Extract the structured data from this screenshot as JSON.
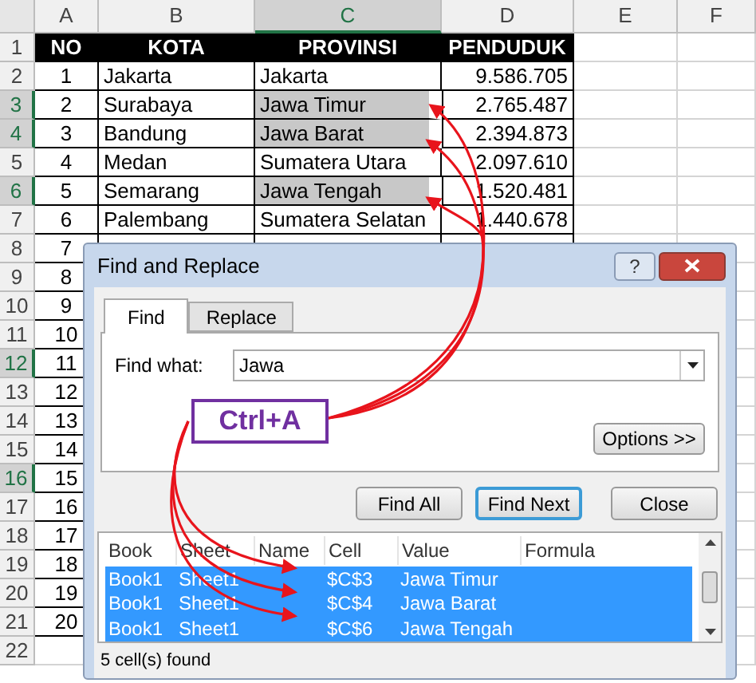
{
  "spreadsheet": {
    "column_headers": [
      {
        "label": "A",
        "selected": false
      },
      {
        "label": "B",
        "selected": false
      },
      {
        "label": "C",
        "selected": true
      },
      {
        "label": "D",
        "selected": false
      },
      {
        "label": "E",
        "selected": false
      },
      {
        "label": "F",
        "selected": false
      }
    ],
    "row_headers": [
      {
        "label": "1",
        "selected": false
      },
      {
        "label": "2",
        "selected": false
      },
      {
        "label": "3",
        "selected": true
      },
      {
        "label": "4",
        "selected": true
      },
      {
        "label": "5",
        "selected": false
      },
      {
        "label": "6",
        "selected": true
      },
      {
        "label": "7",
        "selected": false
      },
      {
        "label": "8",
        "selected": false
      },
      {
        "label": "9",
        "selected": false
      },
      {
        "label": "10",
        "selected": false
      },
      {
        "label": "11",
        "selected": false
      },
      {
        "label": "12",
        "selected": true
      },
      {
        "label": "13",
        "selected": false
      },
      {
        "label": "14",
        "selected": false
      },
      {
        "label": "15",
        "selected": false
      },
      {
        "label": "16",
        "selected": true
      },
      {
        "label": "17",
        "selected": false
      },
      {
        "label": "18",
        "selected": false
      },
      {
        "label": "19",
        "selected": false
      },
      {
        "label": "20",
        "selected": false
      },
      {
        "label": "21",
        "selected": false
      },
      {
        "label": "22",
        "selected": false
      }
    ],
    "table_header": [
      "NO",
      "KOTA",
      "PROVINSI",
      "PENDUDUK"
    ],
    "rows": [
      {
        "no": "1",
        "kota": "Jakarta",
        "provinsi": "Jakarta",
        "penduduk": "9.586.705",
        "found": false
      },
      {
        "no": "2",
        "kota": "Surabaya",
        "provinsi": "Jawa Timur",
        "penduduk": "2.765.487",
        "found": true
      },
      {
        "no": "3",
        "kota": "Bandung",
        "provinsi": "Jawa Barat",
        "penduduk": "2.394.873",
        "found": true
      },
      {
        "no": "4",
        "kota": "Medan",
        "provinsi": "Sumatera Utara",
        "penduduk": "2.097.610",
        "found": false
      },
      {
        "no": "5",
        "kota": "Semarang",
        "provinsi": "Jawa Tengah",
        "penduduk": "1.520.481",
        "found": true
      },
      {
        "no": "6",
        "kota": "Palembang",
        "provinsi": "Sumatera Selatan",
        "penduduk": "1.440.678",
        "found": false
      }
    ],
    "more_numbers": [
      "7",
      "8",
      "9",
      "10",
      "11",
      "12",
      "13",
      "14",
      "15",
      "16",
      "17",
      "18",
      "19",
      "20"
    ]
  },
  "dialog": {
    "title": "Find and Replace",
    "help": "?",
    "tabs": [
      {
        "label": "Find",
        "selected": true
      },
      {
        "label": "Replace",
        "selected": false
      }
    ],
    "find_what": {
      "label": "Find what:",
      "value": "Jawa"
    },
    "options_button": "Options >>",
    "buttons": [
      {
        "label": "Find All",
        "focused": false
      },
      {
        "label": "Find Next",
        "focused": true
      },
      {
        "label": "Close",
        "focused": false
      }
    ],
    "results": {
      "columns": [
        "Book",
        "Sheet",
        "Name",
        "Cell",
        "Value",
        "Formula"
      ],
      "rows": [
        {
          "book": "Book1",
          "sheet": "Sheet1",
          "cell": "$C$3",
          "value": "Jawa Timur",
          "selected": true
        },
        {
          "book": "Book1",
          "sheet": "Sheet1",
          "cell": "$C$4",
          "value": "Jawa Barat",
          "selected": true
        },
        {
          "book": "Book1",
          "sheet": "Sheet1",
          "cell": "$C$6",
          "value": "Jawa Tengah",
          "selected": true
        }
      ]
    },
    "status": "5 cell(s) found"
  },
  "annotation": {
    "label": "Ctrl+A"
  }
}
